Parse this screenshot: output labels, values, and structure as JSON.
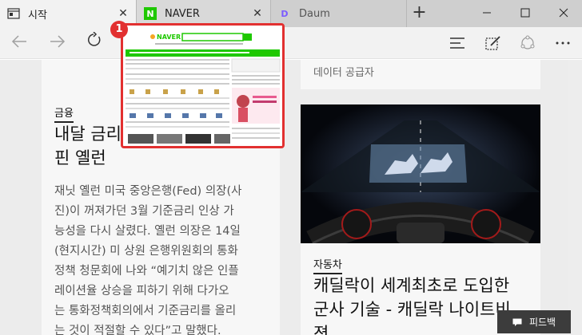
{
  "tabs": [
    {
      "label": "시작",
      "icon": "start-page-icon",
      "active": true
    },
    {
      "label": "NAVER",
      "icon": "naver-favicon",
      "favicon_text": "N",
      "favicon_color": "#1ec800"
    },
    {
      "label": "Daum",
      "icon": "daum-favicon",
      "favicon_text": "D"
    }
  ],
  "window_controls": [
    "minimize-icon",
    "maximize-icon",
    "close-icon"
  ],
  "toolbar_icons": [
    "back-arrow-icon",
    "forward-arrow-icon",
    "refresh-icon",
    "hub-icon",
    "web-note-icon",
    "share-icon",
    "more-icon"
  ],
  "preview": {
    "badge_number": "1",
    "logo_text": "NAVER",
    "accent_color": "#1ec800"
  },
  "left_article": {
    "category": "금융",
    "headline_line1": "내달 금리",
    "headline_line2": "핀 옐런",
    "body_lines": [
      "재닛 옐런 미국 중앙은행(Fed) 의장(사",
      "진)이 꺼져가던 3월 기준금리 인상 가",
      "능성을 다시 살렸다. 옐런 의장은 14일",
      "(현지시간) 미 상원 은행위원회의 통화",
      "정책 청문회에 나와 “예기치 않은 인플",
      "레이션율 상승을 피하기 위해 다가오",
      "는 통화정책회의에서 기준금리를 올리",
      "는 것이 적절할 수 있다”고 말했다."
    ]
  },
  "right_article": {
    "provider": "데이터 공급자",
    "category": "자동차",
    "headline_line1": "캐딜락이 세계최초로 도입한",
    "headline_line2": "군사 기술 - 캐딜락 나이트비",
    "headline_line3": "젼"
  },
  "feedback": {
    "label": "피드백"
  }
}
